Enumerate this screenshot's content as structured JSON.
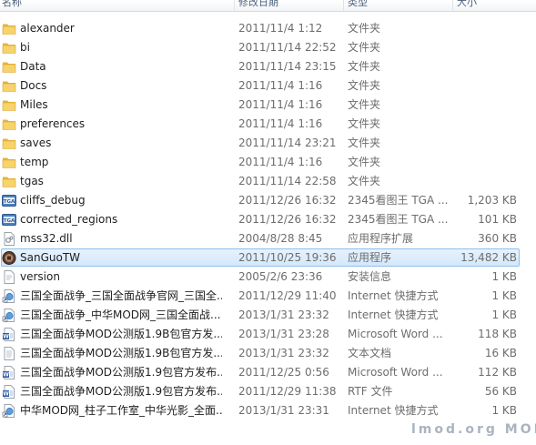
{
  "header": {
    "col_name": "名称",
    "col_date": "修改日期",
    "col_type": "类型",
    "col_size": "大小"
  },
  "files": [
    {
      "name": "alexander",
      "date": "2011/11/4 1:12",
      "type": "文件夹",
      "size": "",
      "icon": "folder-icon"
    },
    {
      "name": "bi",
      "date": "2011/11/14 22:52",
      "type": "文件夹",
      "size": "",
      "icon": "folder-icon"
    },
    {
      "name": "Data",
      "date": "2011/11/14 23:15",
      "type": "文件夹",
      "size": "",
      "icon": "folder-icon"
    },
    {
      "name": "Docs",
      "date": "2011/11/4 1:16",
      "type": "文件夹",
      "size": "",
      "icon": "folder-icon"
    },
    {
      "name": "Miles",
      "date": "2011/11/4 1:16",
      "type": "文件夹",
      "size": "",
      "icon": "folder-icon"
    },
    {
      "name": "preferences",
      "date": "2011/11/4 1:16",
      "type": "文件夹",
      "size": "",
      "icon": "folder-icon"
    },
    {
      "name": "saves",
      "date": "2011/11/14 23:21",
      "type": "文件夹",
      "size": "",
      "icon": "folder-icon"
    },
    {
      "name": "temp",
      "date": "2011/11/4 1:16",
      "type": "文件夹",
      "size": "",
      "icon": "folder-icon"
    },
    {
      "name": "tgas",
      "date": "2011/11/14 22:58",
      "type": "文件夹",
      "size": "",
      "icon": "folder-icon"
    },
    {
      "name": "cliffs_debug",
      "date": "2011/12/26 16:32",
      "type": "2345看图王 TGA ...",
      "size": "1,203 KB",
      "icon": "tga-image-icon"
    },
    {
      "name": "corrected_regions",
      "date": "2011/12/26 16:32",
      "type": "2345看图王 TGA ...",
      "size": "101 KB",
      "icon": "tga-image-icon"
    },
    {
      "name": "mss32.dll",
      "date": "2004/8/28 8:45",
      "type": "应用程序扩展",
      "size": "360 KB",
      "icon": "dll-icon"
    },
    {
      "name": "SanGuoTW",
      "date": "2011/10/25 19:36",
      "type": "应用程序",
      "size": "13,482 KB",
      "icon": "game-exe-icon",
      "selected": true
    },
    {
      "name": "version",
      "date": "2005/2/6 23:36",
      "type": "安装信息",
      "size": "1 KB",
      "icon": "setup-info-icon"
    },
    {
      "name": "三国全面战争_三国全面战争官网_三国全...",
      "date": "2011/12/29 11:40",
      "type": "Internet 快捷方式",
      "size": "1 KB",
      "icon": "internet-shortcut-icon"
    },
    {
      "name": "三国全面战争_中华MOD网_三国全面战...",
      "date": "2013/1/31 23:32",
      "type": "Internet 快捷方式",
      "size": "1 KB",
      "icon": "internet-shortcut-icon"
    },
    {
      "name": "三国全面战争MOD公测版1.9B包官方发...",
      "date": "2013/1/31 23:28",
      "type": "Microsoft Word ...",
      "size": "118 KB",
      "icon": "word-document-icon"
    },
    {
      "name": "三国全面战争MOD公测版1.9B包官方发...",
      "date": "2013/1/31 23:32",
      "type": "文本文档",
      "size": "16 KB",
      "icon": "text-document-icon"
    },
    {
      "name": "三国全面战争MOD公测版1.9包官方发布...",
      "date": "2011/12/25 0:56",
      "type": "Microsoft Word ...",
      "size": "112 KB",
      "icon": "word-document-icon"
    },
    {
      "name": "三国全面战争MOD公测版1.9包官方发布...",
      "date": "2011/12/29 11:38",
      "type": "RTF 文件",
      "size": "56 KB",
      "icon": "word-document-icon"
    },
    {
      "name": "中华MOD网_柱子工作室_中华光影_全面...",
      "date": "2013/1/31 23:31",
      "type": "Internet 快捷方式",
      "size": "1 KB",
      "icon": "internet-shortcut-icon"
    }
  ],
  "watermark": "lmod.org MOD"
}
